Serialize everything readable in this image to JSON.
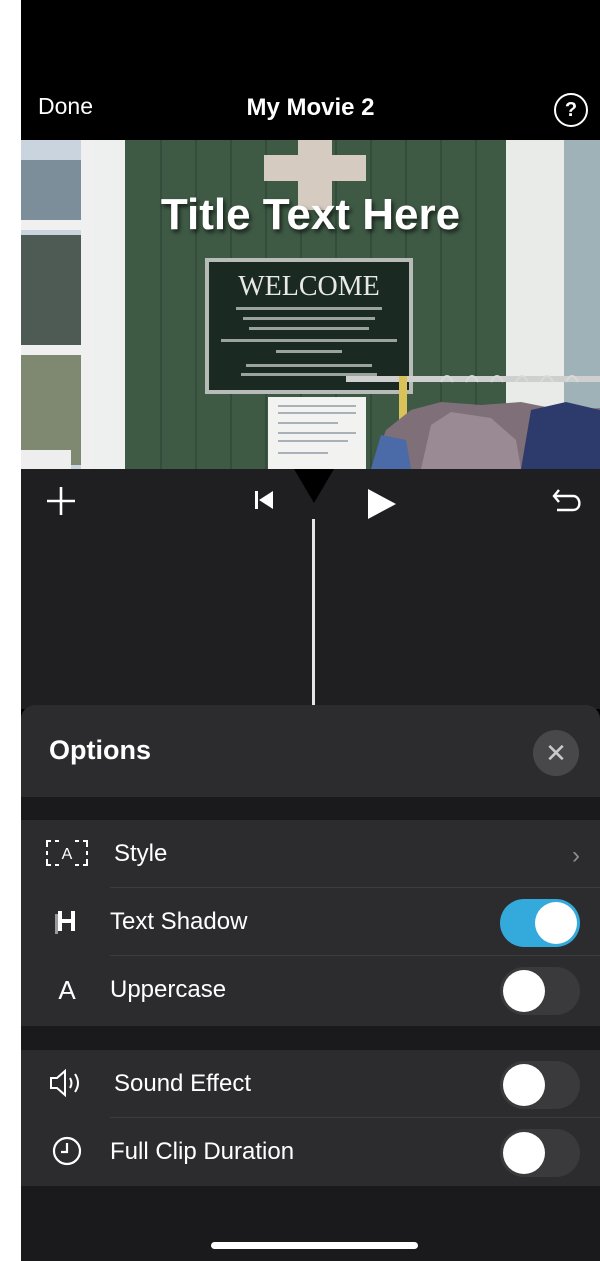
{
  "nav": {
    "done_label": "Done",
    "title": "My Movie 2",
    "help_label": "?"
  },
  "preview": {
    "title_overlay": "Title Text Here",
    "sign_text": "WELCOME"
  },
  "controls": {
    "icons": [
      "plus-icon",
      "skip-to-start-icon",
      "play-icon",
      "undo-icon"
    ]
  },
  "options": {
    "heading": "Options",
    "close_label": "✕",
    "rows": [
      {
        "label": "Style",
        "icon": "style-frame-icon",
        "control": "chevron",
        "chevron": "›"
      },
      {
        "label": "Text Shadow",
        "icon": "text-shadow-icon",
        "control": "toggle",
        "on": true
      },
      {
        "label": "Uppercase",
        "icon": "uppercase-icon",
        "icon_glyph": "A",
        "control": "toggle",
        "on": false
      },
      {
        "label": "Sound Effect",
        "icon": "speaker-icon",
        "control": "toggle",
        "on": false
      },
      {
        "label": "Full Clip Duration",
        "icon": "clock-icon",
        "control": "toggle",
        "on": false
      }
    ]
  },
  "colors": {
    "toggle_on": "#34aadc",
    "sheet_bg": "#2c2c2e"
  }
}
